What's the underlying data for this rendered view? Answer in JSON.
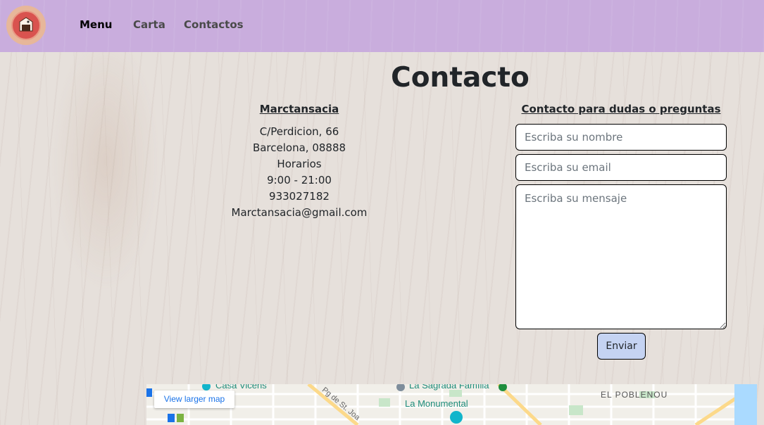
{
  "nav": {
    "items": [
      {
        "label": "Menu",
        "active": true
      },
      {
        "label": "Carta",
        "active": false
      },
      {
        "label": "Contactos",
        "active": false
      }
    ]
  },
  "page": {
    "title": "Contacto"
  },
  "info": {
    "name": "Marctansacia",
    "lines": [
      "C/Perdicion, 66",
      "Barcelona, 08888",
      "Horarios",
      "9:00 - 21:00",
      "933027182",
      "Marctansacia@gmail.com"
    ]
  },
  "form": {
    "heading": "Contacto para dudas o preguntas",
    "name_placeholder": "Escriba su nombre",
    "email_placeholder": "Escriba su email",
    "message_placeholder": "Escriba su mensaje",
    "submit_label": "Enviar"
  },
  "map": {
    "link_label": "View larger map",
    "labels": {
      "casa_vicens": "Casa Vicens",
      "sagrada": "La Sagrada Família",
      "monumental": "La Monumental",
      "poblenou": "EL POBLENOU",
      "street": "Pg de St. Joa"
    }
  },
  "colors": {
    "navbar": "#c9addd",
    "button": "#c5d3f2",
    "logo": "#d9534f"
  }
}
